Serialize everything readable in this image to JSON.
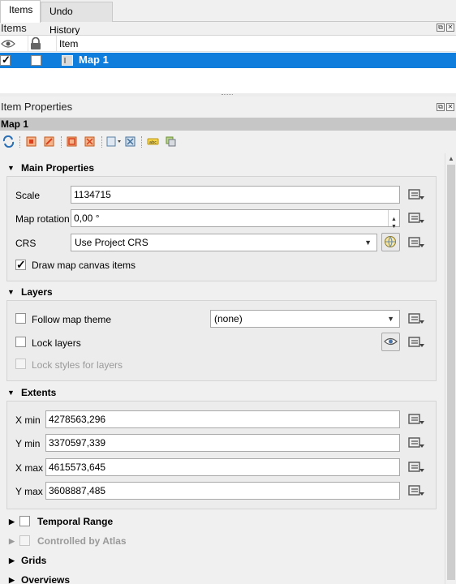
{
  "tabs": [
    {
      "label": "Items"
    },
    {
      "label": "Undo History"
    }
  ],
  "items_panel": {
    "title": "Items",
    "column_item": "Item",
    "row": {
      "name": "Map 1"
    }
  },
  "props_panel": {
    "title": "Item Properties",
    "item_name": "Map 1"
  },
  "sections": {
    "main": "Main Properties",
    "layers": "Layers",
    "extents": "Extents",
    "temporal": "Temporal Range",
    "atlas": "Controlled by Atlas",
    "grids": "Grids",
    "overviews": "Overviews"
  },
  "main_props": {
    "scale_label": "Scale",
    "scale_value": "1134715",
    "rotation_label": "Map rotation",
    "rotation_value": "0,00 °",
    "crs_label": "CRS",
    "crs_value": "Use Project CRS",
    "draw_items_label": "Draw map canvas items"
  },
  "layers_props": {
    "follow_theme_label": "Follow map theme",
    "theme_value": "(none)",
    "lock_layers_label": "Lock layers",
    "lock_styles_label": "Lock styles for layers"
  },
  "extents_props": {
    "xmin_label": "X min",
    "xmin_value": "4278563,296",
    "ymin_label": "Y min",
    "ymin_value": "3370597,339",
    "xmax_label": "X max",
    "xmax_value": "4615573,645",
    "ymax_label": "Y max",
    "ymax_value": "3608887,485"
  },
  "colors": {
    "selection": "#0e7ddb",
    "title_band": "#c6c6c6"
  }
}
